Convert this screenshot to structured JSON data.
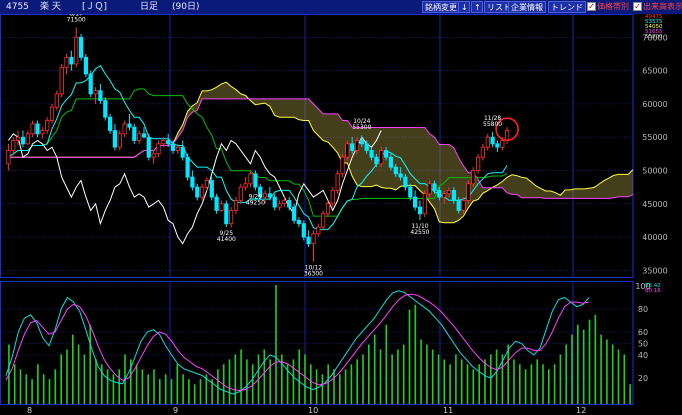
{
  "header": {
    "code": "4755",
    "name": "楽  天",
    "market": "[ＪＱ]",
    "period": "日足",
    "range": "(90日)",
    "buttons": [
      "銘柄変更",
      "↓",
      "↑",
      "リスト",
      "企業情報",
      "トレンド"
    ],
    "toggles": [
      {
        "label": "価格帯別",
        "checked": true
      },
      {
        "label": "出来高表示",
        "checked": true
      }
    ]
  },
  "legend_values": [
    "49475",
    "53575",
    "54050",
    "51655",
    "55800"
  ],
  "osc_legend": [
    "83.42",
    "80.16"
  ],
  "colors": {
    "tenkan": "#00ffff",
    "kijun": "#00c000",
    "senkouA": "#ffff40",
    "senkouB": "#ff40ff",
    "chikou": "#ffffff",
    "cloud": "#9a8a3c",
    "up": "#ff3030",
    "down": "#00e8ff",
    "stochK": "#00e0e0",
    "stochD": "#ff40ff",
    "volume": "#20d020",
    "grid": "#1a2fd0",
    "highlight": "#ff2020"
  },
  "chart_data": [
    {
      "type": "candlestick",
      "title": "",
      "ylim": [
        34000,
        73500
      ],
      "y_ticks": [
        35000,
        40000,
        45000,
        50000,
        55000,
        60000,
        65000,
        70000
      ],
      "x_month_labels": [
        "8",
        "9",
        "10",
        "11",
        "12"
      ],
      "candles": [
        [
          51000,
          54000,
          50000,
          53000
        ],
        [
          53000,
          55000,
          52500,
          54500
        ],
        [
          54500,
          56000,
          53800,
          55000
        ],
        [
          55000,
          56000,
          53500,
          54000
        ],
        [
          54000,
          56000,
          53800,
          55500
        ],
        [
          55500,
          57500,
          55000,
          57000
        ],
        [
          57000,
          57500,
          55000,
          55500
        ],
        [
          55500,
          56500,
          54800,
          56000
        ],
        [
          56000,
          58000,
          55500,
          57500
        ],
        [
          57500,
          60000,
          57000,
          59500
        ],
        [
          59500,
          62000,
          59000,
          61500
        ],
        [
          61500,
          66000,
          61000,
          65500
        ],
        [
          65500,
          67500,
          64500,
          67000
        ],
        [
          67000,
          68000,
          65000,
          66000
        ],
        [
          66000,
          71500,
          65500,
          70000
        ],
        [
          70000,
          70500,
          66500,
          67000
        ],
        [
          67000,
          67500,
          64000,
          64500
        ],
        [
          64500,
          65000,
          61000,
          61500
        ],
        [
          61500,
          62500,
          60000,
          62000
        ],
        [
          62000,
          63000,
          60000,
          60500
        ],
        [
          60500,
          61000,
          57500,
          58000
        ],
        [
          58000,
          58500,
          55500,
          56000
        ],
        [
          56000,
          57000,
          53000,
          53500
        ],
        [
          53500,
          56000,
          53000,
          55500
        ],
        [
          55500,
          57500,
          55000,
          57000
        ],
        [
          57000,
          58500,
          56000,
          56500
        ],
        [
          56500,
          57000,
          54000,
          54500
        ],
        [
          54500,
          56000,
          54000,
          55500
        ],
        [
          55500,
          56500,
          54800,
          55000
        ],
        [
          55000,
          55500,
          51500,
          52000
        ],
        [
          52000,
          53000,
          51000,
          52500
        ],
        [
          52500,
          54500,
          52000,
          54000
        ],
        [
          54000,
          55000,
          53500,
          54500
        ],
        [
          54500,
          55500,
          53500,
          54000
        ],
        [
          54000,
          54500,
          52500,
          53000
        ],
        [
          53000,
          54000,
          52500,
          53500
        ],
        [
          53500,
          54500,
          51500,
          52000
        ],
        [
          52000,
          52500,
          48500,
          49000
        ],
        [
          49000,
          50000,
          47000,
          47500
        ],
        [
          47500,
          48000,
          45500,
          46000
        ],
        [
          46000,
          48000,
          45500,
          47500
        ],
        [
          47500,
          49000,
          47000,
          48500
        ],
        [
          48500,
          49000,
          45500,
          46000
        ],
        [
          46000,
          46500,
          43500,
          44000
        ],
        [
          44000,
          45500,
          43800,
          45000
        ],
        [
          45000,
          45500,
          41500,
          42000
        ],
        [
          42000,
          44500,
          41400,
          44000
        ],
        [
          44000,
          46000,
          43500,
          45500
        ],
        [
          45500,
          48000,
          45000,
          47500
        ],
        [
          47500,
          49000,
          47000,
          48000
        ],
        [
          48000,
          50000,
          47500,
          49500
        ],
        [
          49500,
          50000,
          47000,
          47500
        ],
        [
          47500,
          48000,
          45500,
          46000
        ],
        [
          46000,
          47000,
          45000,
          46500
        ],
        [
          46500,
          47500,
          45500,
          46000
        ],
        [
          46000,
          46500,
          44000,
          44500
        ],
        [
          44500,
          45500,
          44000,
          45000
        ],
        [
          45000,
          46000,
          44500,
          45500
        ],
        [
          45500,
          46000,
          44000,
          44500
        ],
        [
          44500,
          45000,
          42000,
          42500
        ],
        [
          42500,
          43000,
          41500,
          42000
        ],
        [
          42000,
          42500,
          39500,
          40000
        ],
        [
          40000,
          41000,
          38500,
          39000
        ],
        [
          39000,
          41000,
          36300,
          40500
        ],
        [
          40500,
          42000,
          40000,
          41500
        ],
        [
          41500,
          44000,
          41000,
          43500
        ],
        [
          43500,
          45500,
          43000,
          45000
        ],
        [
          45000,
          47500,
          44500,
          47000
        ],
        [
          47000,
          50000,
          46500,
          49500
        ],
        [
          49500,
          52500,
          49000,
          52000
        ],
        [
          52000,
          54500,
          51500,
          54000
        ],
        [
          54000,
          55000,
          52500,
          53000
        ],
        [
          53000,
          55000,
          52500,
          54500
        ],
        [
          54500,
          55300,
          53500,
          54000
        ],
        [
          54000,
          54500,
          52500,
          53000
        ],
        [
          53000,
          53500,
          51500,
          52000
        ],
        [
          52000,
          52500,
          50500,
          51000
        ],
        [
          51000,
          53500,
          50500,
          53000
        ],
        [
          53000,
          53500,
          51500,
          52000
        ],
        [
          52000,
          52500,
          50000,
          50500
        ],
        [
          50500,
          51000,
          49000,
          49500
        ],
        [
          49500,
          50500,
          48500,
          49000
        ],
        [
          49000,
          49500,
          47000,
          47500
        ],
        [
          47500,
          48000,
          45500,
          46000
        ],
        [
          46000,
          47000,
          44000,
          44500
        ],
        [
          44500,
          45500,
          42550,
          43500
        ],
        [
          43500,
          47000,
          43000,
          46500
        ],
        [
          46500,
          48500,
          46000,
          48000
        ],
        [
          48000,
          48500,
          46500,
          47000
        ],
        [
          47000,
          47500,
          45500,
          46000
        ],
        [
          46000,
          47000,
          45000,
          46500
        ],
        [
          46500,
          47500,
          46000,
          47000
        ],
        [
          47000,
          47500,
          45000,
          45500
        ],
        [
          45500,
          46000,
          43500,
          44000
        ],
        [
          44000,
          46000,
          43500,
          45500
        ],
        [
          45500,
          48500,
          45000,
          48000
        ],
        [
          48000,
          50500,
          47500,
          50000
        ],
        [
          50000,
          52500,
          49500,
          52000
        ],
        [
          52000,
          54000,
          51500,
          53500
        ],
        [
          53500,
          55500,
          53000,
          55000
        ],
        [
          55000,
          55800,
          53500,
          54000
        ],
        [
          54000,
          54500,
          52800,
          53500
        ],
        [
          53500,
          55000,
          53000,
          54500
        ],
        [
          54500,
          56500,
          54000,
          56000
        ]
      ],
      "annotations": [
        {
          "index": 14,
          "label": "8/17",
          "value": "71500"
        },
        {
          "index": 45,
          "label": "9/25",
          "value": "41400"
        },
        {
          "index": 51,
          "label": "9/29",
          "value": "49250"
        },
        {
          "index": 63,
          "label": "10/12",
          "value": "36300"
        },
        {
          "index": 73,
          "label": "10/24",
          "value": "55300"
        },
        {
          "index": 85,
          "label": "11/10",
          "value": "42550"
        },
        {
          "index": 100,
          "label": "11/28",
          "value": "55800"
        }
      ],
      "highlight_index": 103
    },
    {
      "type": "line",
      "title": "",
      "ylim": [
        0,
        100
      ],
      "y_ticks": [
        20,
        40,
        50,
        60,
        80,
        100
      ],
      "series": [
        {
          "values": [
            22,
            38,
            60,
            72,
            75,
            68,
            55,
            48,
            62,
            80,
            90,
            86,
            78,
            62,
            45,
            30,
            22,
            18,
            16,
            15,
            25,
            38,
            52,
            60,
            62,
            58,
            48,
            40,
            32,
            28,
            26,
            24,
            22,
            18,
            14,
            10,
            8,
            6,
            8,
            12,
            18,
            26,
            34,
            40,
            38,
            32,
            26,
            20,
            16,
            12,
            10,
            12,
            16,
            22,
            30,
            38,
            46,
            54,
            60,
            66,
            72,
            80,
            88,
            94,
            96,
            94,
            90,
            86,
            82,
            78,
            72,
            66,
            58,
            50,
            42,
            36,
            30,
            26,
            22,
            20,
            26,
            36,
            46,
            52,
            50,
            44,
            40,
            46,
            62,
            78,
            88,
            90,
            86,
            82,
            84,
            90
          ]
        },
        {
          "values": [
            18,
            28,
            44,
            58,
            68,
            70,
            64,
            58,
            60,
            70,
            80,
            84,
            82,
            74,
            62,
            48,
            36,
            28,
            22,
            18,
            20,
            28,
            38,
            48,
            56,
            60,
            58,
            52,
            44,
            38,
            34,
            30,
            28,
            24,
            20,
            16,
            12,
            10,
            9,
            10,
            13,
            18,
            24,
            30,
            34,
            34,
            32,
            28,
            24,
            20,
            16,
            14,
            15,
            18,
            23,
            29,
            36,
            43,
            50,
            56,
            62,
            68,
            75,
            82,
            88,
            92,
            93,
            92,
            89,
            86,
            82,
            77,
            71,
            65,
            58,
            51,
            44,
            38,
            33,
            29,
            27,
            30,
            36,
            42,
            46,
            46,
            44,
            44,
            50,
            60,
            72,
            82,
            86,
            86,
            85,
            86
          ]
        }
      ]
    },
    {
      "type": "bar",
      "title": "",
      "ylim": [
        0,
        120
      ],
      "values": [
        60,
        40,
        35,
        30,
        25,
        40,
        30,
        25,
        35,
        50,
        55,
        70,
        60,
        50,
        80,
        45,
        40,
        35,
        30,
        35,
        50,
        45,
        40,
        35,
        30,
        35,
        25,
        30,
        25,
        40,
        30,
        25,
        20,
        25,
        30,
        25,
        35,
        40,
        45,
        50,
        55,
        45,
        40,
        50,
        55,
        45,
        120,
        50,
        40,
        45,
        55,
        50,
        40,
        35,
        30,
        40,
        35,
        30,
        35,
        40,
        45,
        50,
        60,
        70,
        55,
        80,
        50,
        55,
        60,
        95,
        100,
        65,
        60,
        55,
        50,
        45,
        40,
        50,
        45,
        40,
        35,
        40,
        45,
        50,
        55,
        50,
        60,
        45,
        40,
        35,
        40,
        45,
        40,
        35,
        40,
        50,
        60,
        70,
        80,
        75,
        85,
        90,
        70,
        65,
        60,
        55,
        50,
        20
      ]
    }
  ]
}
